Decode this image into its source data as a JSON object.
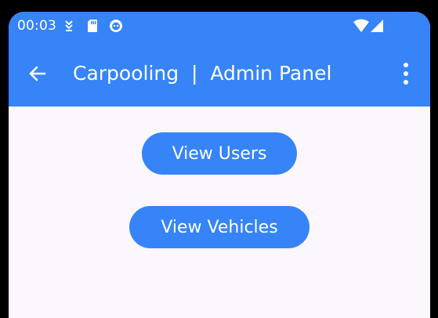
{
  "status_bar": {
    "time": "00:03",
    "icons": [
      "download-icon",
      "sd-card-icon",
      "app-notification-icon",
      "wifi-icon",
      "cell-signal-icon"
    ]
  },
  "app_bar": {
    "title": "Carpooling  |  Admin Panel",
    "back_icon": "arrow-back-icon",
    "menu_icon": "more-vert-icon"
  },
  "actions": {
    "view_users_label": "View Users",
    "view_vehicles_label": "View Vehicles"
  },
  "colors": {
    "primary": "#3684F7",
    "background": "#FCF6FD",
    "on_primary": "#FFFFFF"
  }
}
